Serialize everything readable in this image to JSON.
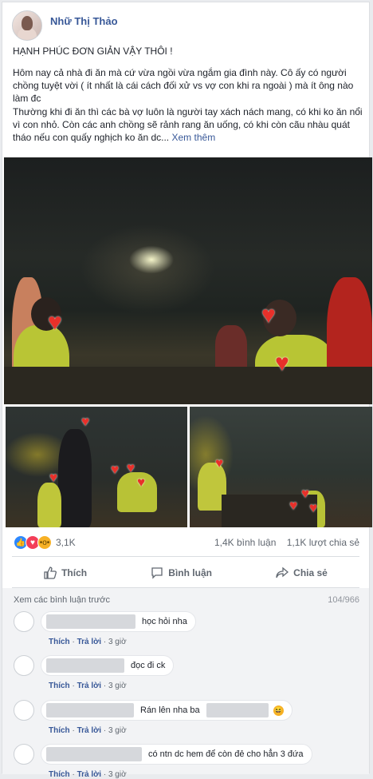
{
  "post": {
    "author": "Nhữ Thị Thảo",
    "headline": "HẠNH PHÚC ĐƠN GIẢN VẬY THÔI !",
    "paragraph1": "Hôm nay cả nhà đi ăn mà cứ vừa ngồi vừa ngắm gia đình này. Cô ấy có người chồng tuyệt vời ( ít nhất là cái cách đối xử vs vợ con khi ra ngoài ) mà ít ông nào làm đc",
    "paragraph2": "Thường khi đi ăn thì các bà vợ luôn là người tay xách nách mang, có khi ko ăn nổi vì con nhỏ. Còn các anh chồng sẽ rảnh rang ăn uống, có khi còn cãu nhàu quát tháo nếu con quấy nghịch ko ăn dc...",
    "see_more": "Xem thêm"
  },
  "stats": {
    "reaction_count": "3,1K",
    "comment_count": "1,4K bình luận",
    "share_count": "1,1K lượt chia sẻ",
    "reaction_icons": [
      "like-icon",
      "love-icon",
      "wow-icon"
    ]
  },
  "actions": {
    "like": "Thích",
    "comment": "Bình luận",
    "share": "Chia sẻ"
  },
  "comments": {
    "view_previous": "Xem các bình luận trước",
    "counter": "104/966",
    "meta": {
      "like": "Thích",
      "reply": "Trả lời",
      "separator": "·"
    },
    "items": [
      {
        "text": "học hỏi nha",
        "time": "3 giờ"
      },
      {
        "text": "đọc đi ck",
        "time": "3 giờ"
      },
      {
        "text": "Rán lên nha ba",
        "time": "3 giờ"
      },
      {
        "text": "có ntn dc hem để còn đẻ cho hẳn 3 đứa",
        "time": "3 giờ"
      }
    ]
  },
  "colors": {
    "link": "#385898",
    "heart": "#e8302a",
    "like_blue": "#2d88ff"
  }
}
